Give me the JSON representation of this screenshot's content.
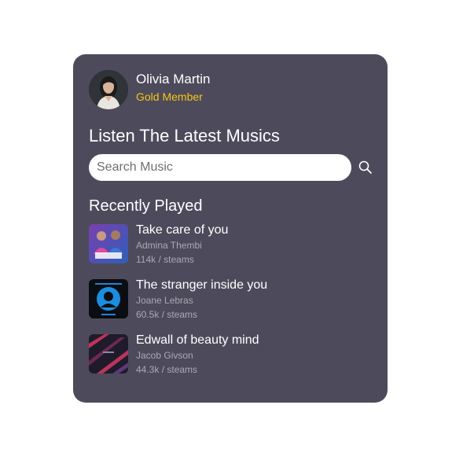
{
  "profile": {
    "name": "Olivia Martin",
    "tier": "Gold Member",
    "avatar_icon": "user-avatar"
  },
  "heading": "Listen The Latest Musics",
  "search": {
    "placeholder": "Search Music",
    "value": "",
    "icon": "search-icon"
  },
  "recently_played": {
    "title": "Recently Played",
    "tracks": [
      {
        "title": "Take care of you",
        "artist": "Admina Thembi",
        "streams": "114k / steams",
        "cover_icon": "album-cover-duo"
      },
      {
        "title": "The stranger inside you",
        "artist": "Joane Lebras",
        "streams": "60.5k / steams",
        "cover_icon": "album-cover-silhouette"
      },
      {
        "title": "Edwall of beauty mind",
        "artist": "Jacob Givson",
        "streams": "44.3k / steams",
        "cover_icon": "album-cover-abstract"
      }
    ]
  },
  "colors": {
    "card_background": "#4d4b5b",
    "accent_gold": "#f5c518",
    "muted_text": "#a9a8b3"
  }
}
